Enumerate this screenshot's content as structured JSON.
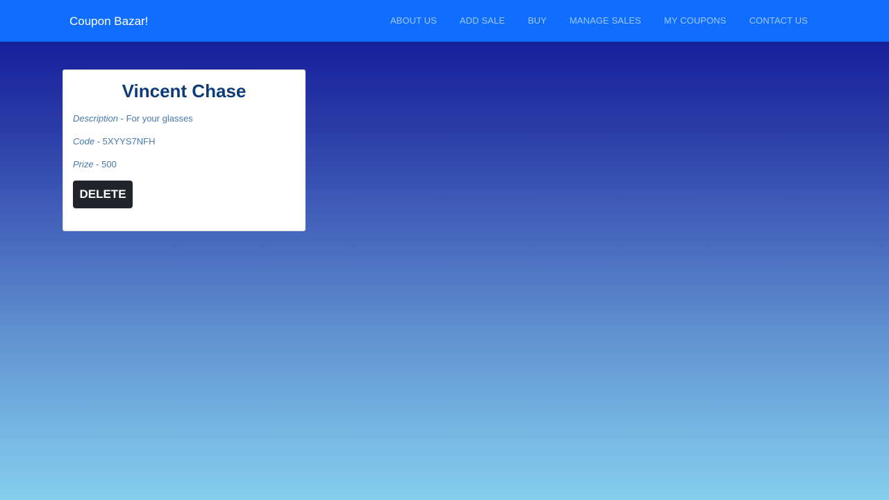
{
  "navbar": {
    "brand": "Coupon Bazar!",
    "links": [
      "ABOUT US",
      "ADD SALE",
      "BUY",
      "MANAGE SALES",
      "MY COUPONS",
      "CONTACT US"
    ]
  },
  "card": {
    "title": "Vincent Chase",
    "description_label": "Description",
    "description_value": " - For your glasses",
    "code_label": "Code",
    "code_value": " - 5XYYS7NFH",
    "prize_label": "Prize",
    "prize_value": " - 500",
    "delete_label": "DELETE"
  },
  "colors": {
    "navbar": "#0f6efd",
    "title": "#0d3a78",
    "button": "#212529"
  }
}
